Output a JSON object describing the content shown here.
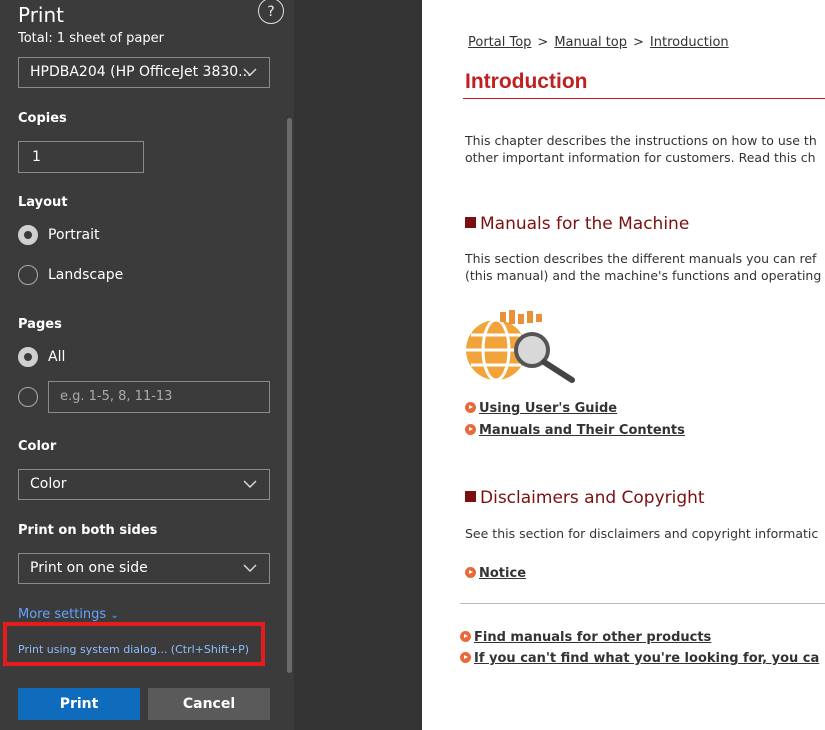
{
  "print_panel": {
    "title": "Print",
    "subtitle": "Total: 1 sheet of paper",
    "help_label": "?",
    "printer": "HPDBA204 (HP OfficeJet 3830...",
    "copies": {
      "label": "Copies",
      "value": "1"
    },
    "layout": {
      "label": "Layout",
      "options": [
        "Portrait",
        "Landscape"
      ],
      "selected": "Portrait"
    },
    "pages": {
      "label": "Pages",
      "all_label": "All",
      "range_placeholder": "e.g. 1-5, 8, 11-13",
      "selected": "All"
    },
    "color": {
      "label": "Color",
      "value": "Color"
    },
    "duplex": {
      "label": "Print on both sides",
      "value": "Print on one side"
    },
    "more_settings": "More settings",
    "system_dialog": "Print using system dialog... (Ctrl+Shift+P)",
    "print_button": "Print",
    "cancel_button": "Cancel"
  },
  "document": {
    "breadcrumb": [
      "Portal Top",
      "Manual top",
      "Introduction"
    ],
    "breadcrumb_sep": ">",
    "title": "Introduction",
    "intro_lines": [
      "This chapter describes the instructions on how to use th",
      "other important information for customers. Read this ch"
    ],
    "sections": [
      {
        "heading": "Manuals for the Machine",
        "lines": [
          "This section describes the different manuals you can ref",
          "(this manual) and the machine's functions and operating"
        ],
        "links": [
          "Using User's Guide",
          "Manuals and Their Contents"
        ]
      },
      {
        "heading": "Disclaimers and Copyright",
        "lines": [
          "See this section for disclaimers and copyright informatic"
        ],
        "links": [
          "Notice"
        ]
      }
    ],
    "footer_links": [
      "Find manuals for other products",
      "If you can't find what you're looking for, you ca"
    ]
  },
  "colors": {
    "panel_bg": "#3b3b3b",
    "print_button": "#0f6cbd",
    "highlight_box": "#e41c1c",
    "heading_red": "#c02020",
    "section_heading": "#7a1010"
  }
}
